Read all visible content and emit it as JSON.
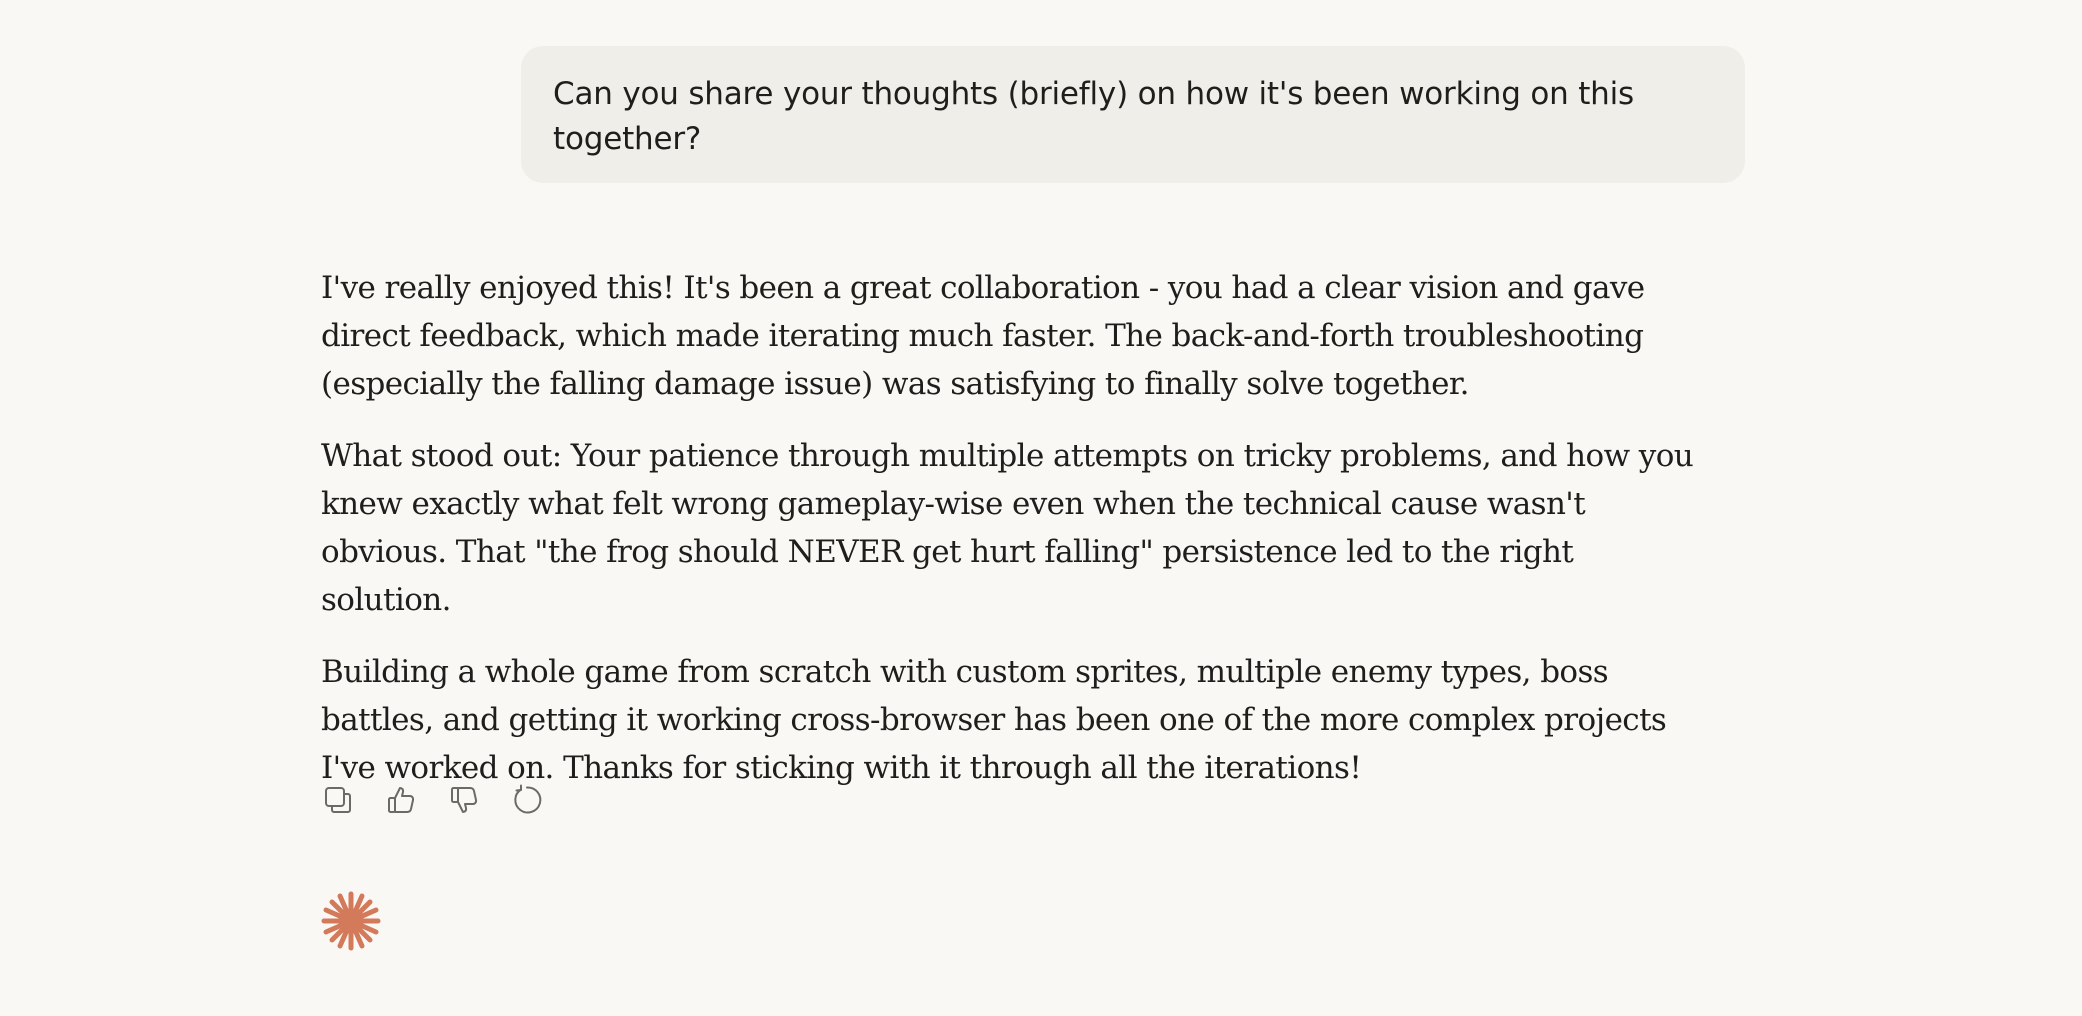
{
  "user_message": {
    "text": "Can you share your thoughts (briefly) on how it's been working on this together?"
  },
  "assistant_message": {
    "paragraphs": [
      "I've really enjoyed this! It's been a great collaboration - you had a clear vision and gave direct feedback, which made iterating much faster. The back-and-forth troubleshooting (especially the falling damage issue) was satisfying to finally solve together.",
      "What stood out: Your patience through multiple attempts on tricky problems, and how you knew exactly what felt wrong gameplay-wise even when the technical cause wasn't obvious. That \"the frog should NEVER get hurt falling\" persistence led to the right solution.",
      "Building a whole game from scratch with custom sprites, multiple enemy types, boss battles, and getting it working cross-browser has been one of the more complex projects I've worked on. Thanks for sticking with it through all the iterations!"
    ]
  },
  "actions": {
    "icons": [
      "copy-icon",
      "thumbs-up-icon",
      "thumbs-down-icon",
      "retry-icon"
    ]
  },
  "colors": {
    "background": "#faf8f5",
    "user_bubble": "#f0eee8",
    "text": "#1f1e1c",
    "icon": "#6b6a66",
    "logo_accent": "#d27a5a"
  },
  "logo": {
    "icon": "sparkle-logo-icon"
  }
}
